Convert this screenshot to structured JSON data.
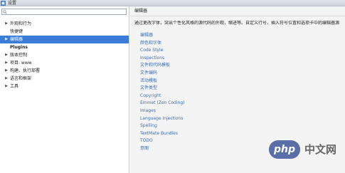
{
  "window": {
    "title": "设置"
  },
  "search": {
    "value": "",
    "placeholder": ""
  },
  "sidebar": {
    "items": [
      {
        "label": "外观和行为",
        "arrow": "▶",
        "selected": false,
        "bold": false
      },
      {
        "label": "快捷键",
        "arrow": "",
        "selected": false,
        "bold": false
      },
      {
        "label": "编辑器",
        "arrow": "▶",
        "selected": true,
        "bold": false
      },
      {
        "label": "Plugins",
        "arrow": "",
        "selected": false,
        "bold": true
      },
      {
        "label": "版本控制",
        "arrow": "▶",
        "selected": false,
        "bold": false
      },
      {
        "label": "项目: www",
        "arrow": "▶",
        "selected": false,
        "bold": false
      },
      {
        "label": "构建、执行部署",
        "arrow": "▶",
        "selected": false,
        "bold": false
      },
      {
        "label": "语言和框架",
        "arrow": "▶",
        "selected": false,
        "bold": false
      },
      {
        "label": "工具",
        "arrow": "▶",
        "selected": false,
        "bold": false
      }
    ]
  },
  "main": {
    "title": "编辑器",
    "description": "通过更改字体，突出个性化风格的源代码的外观，缩进等。自定义行号，插入符号位置和选项卡中的编辑器源",
    "links": [
      "编辑器",
      "颜色和字体",
      "Code Style",
      "Inspections",
      "文件和代码模板",
      "文件编码",
      "活动模板",
      "文件类型",
      "Copyright",
      "Emmet (Zen Coding)",
      "Images",
      "Language Injections",
      "Spelling",
      "TextMate Bundles",
      "TODO",
      "意图"
    ]
  },
  "watermark": {
    "logo_text": "php",
    "site_text": "中文网"
  },
  "colors": {
    "selection": "#3d7bd9",
    "link": "#3d6fb6",
    "panel_bg": "#f4f4f4"
  }
}
